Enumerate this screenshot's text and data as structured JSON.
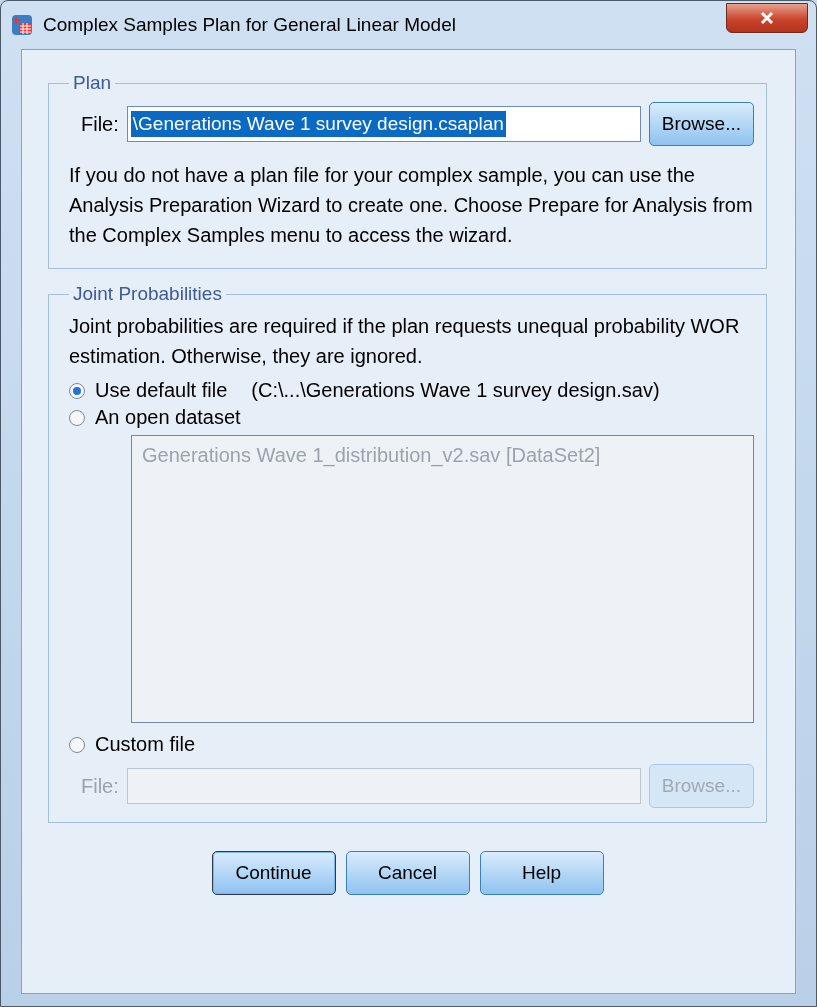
{
  "window": {
    "title": "Complex Samples Plan for General Linear Model"
  },
  "plan": {
    "legend": "Plan",
    "file_label": "File:",
    "file_value": "\\Generations Wave 1 survey design.csaplan",
    "browse": "Browse...",
    "note": "If you do not have a plan file for your complex sample, you can use the Analysis Preparation Wizard to create one. Choose Prepare for Analysis from the Complex Samples menu to access the wizard."
  },
  "joint": {
    "legend": "Joint Probabilities",
    "note": "Joint probabilities are required if the plan requests unequal probability WOR estimation. Otherwise, they are ignored.",
    "options": [
      {
        "kind": "default",
        "label": "Use default file",
        "selected": true,
        "detail": "(C:\\...\\Generations Wave 1 survey design.sav)"
      },
      {
        "kind": "list",
        "label": "An open dataset",
        "selected": false,
        "items": [
          "Generations Wave 1_distribution_v2.sav [DataSet2]"
        ],
        "disabled": true
      },
      {
        "kind": "file",
        "label": "Custom file",
        "selected": false,
        "file_label": "File:",
        "browse": "Browse...",
        "disabled": true
      }
    ]
  },
  "buttons": [
    {
      "label": "Continue",
      "default": true
    },
    {
      "label": "Cancel",
      "default": false
    },
    {
      "label": "Help",
      "default": false
    }
  ]
}
